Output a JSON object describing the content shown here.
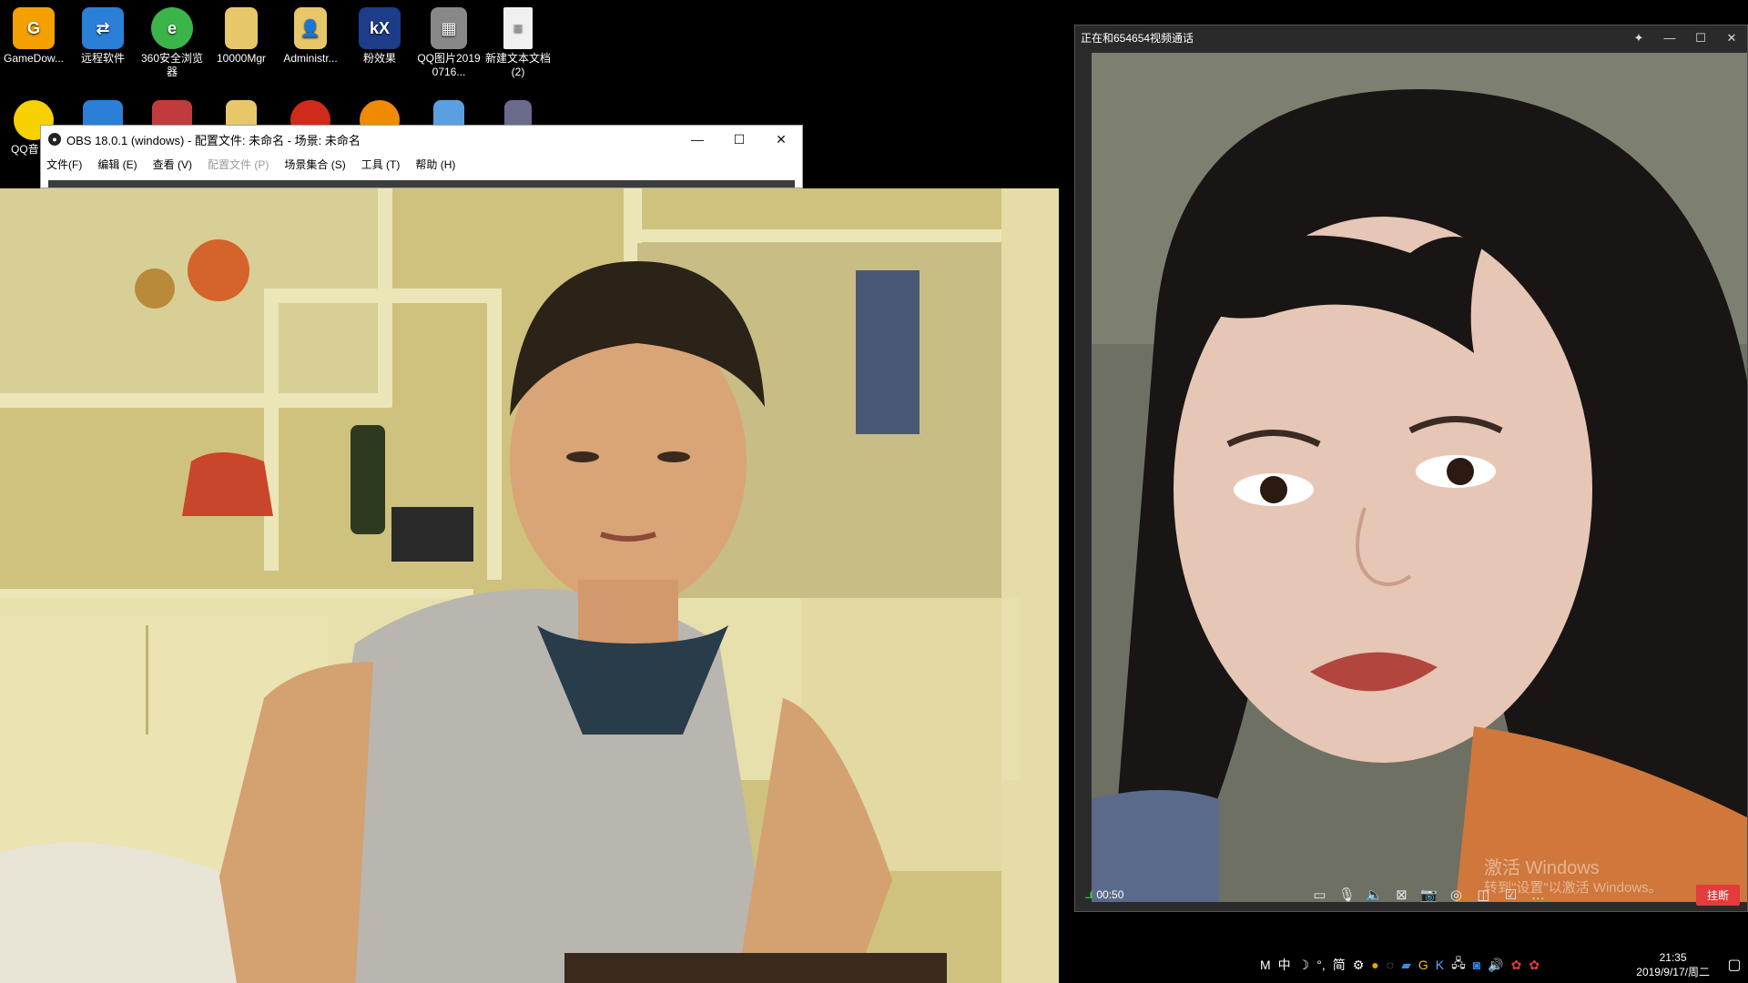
{
  "desktop": {
    "icons_row1": [
      {
        "label": "GameDow...",
        "icon": "game-icon",
        "color": "#f3a000"
      },
      {
        "label": "远程软件",
        "icon": "remote-icon",
        "color": "#2a7fd6"
      },
      {
        "label": "360安全浏览器",
        "icon": "browser-icon",
        "color": "#3bb54a"
      },
      {
        "label": "10000Mgr",
        "icon": "folder-icon",
        "color": "#e8c66a"
      },
      {
        "label": "Administr...",
        "icon": "user-folder-icon",
        "color": "#e8c66a"
      },
      {
        "label": "粉效果",
        "icon": "kx-icon",
        "color": "#1d3d8a"
      },
      {
        "label": "QQ图片20190716...",
        "icon": "image-icon",
        "color": "#888888"
      },
      {
        "label": "新建文本文档(2)",
        "icon": "text-file-icon",
        "color": "#f0f0f0"
      }
    ],
    "icons_row2": [
      {
        "label": "QQ音",
        "icon": "qq-music-icon",
        "color": "#f7d000"
      },
      {
        "label": "",
        "icon": "app-icon",
        "color": "#2a7fd6"
      },
      {
        "label": "",
        "icon": "shield-icon",
        "color": "#c23b3b"
      },
      {
        "label": "",
        "icon": "folder-icon",
        "color": "#e8c66a"
      },
      {
        "label": "",
        "icon": "game-icon",
        "color": "#d02a1a"
      },
      {
        "label": "",
        "icon": "player-icon",
        "color": "#f08a00"
      },
      {
        "label": "",
        "icon": "doc-icon",
        "color": "#5aa0e0"
      },
      {
        "label": "",
        "icon": "tool-icon",
        "color": "#6a6a8a"
      }
    ]
  },
  "obs": {
    "title": "OBS 18.0.1 (windows) - 配置文件: 未命名 - 场景: 未命名",
    "menu": [
      {
        "label": "文件(F)",
        "disabled": false
      },
      {
        "label": "编辑 (E)",
        "disabled": false
      },
      {
        "label": "查看 (V)",
        "disabled": false
      },
      {
        "label": "配置文件 (P)",
        "disabled": true
      },
      {
        "label": "场景集合 (S)",
        "disabled": false
      },
      {
        "label": "工具 (T)",
        "disabled": false
      },
      {
        "label": "帮助 (H)",
        "disabled": false
      }
    ],
    "minimize": "—",
    "maximize": "☐",
    "close": "✕"
  },
  "qq": {
    "title": "正在和654654视频通话",
    "pin": "✦",
    "minimize": "—",
    "maximize": "☐",
    "close": "✕",
    "signal": "....ıl",
    "duration": "00:50",
    "hangup": "挂断"
  },
  "watermark": {
    "line1": "激活 Windows",
    "line2": "转到\"设置\"以激活 Windows。"
  },
  "taskbar": {
    "tray": [
      "M",
      "中",
      "☽",
      "°,",
      "简",
      "⚙"
    ],
    "time": "21:35",
    "date": "2019/9/17/周二"
  },
  "colors": {
    "hangup": "#e23c3c",
    "signal": "#3ecf3e"
  }
}
